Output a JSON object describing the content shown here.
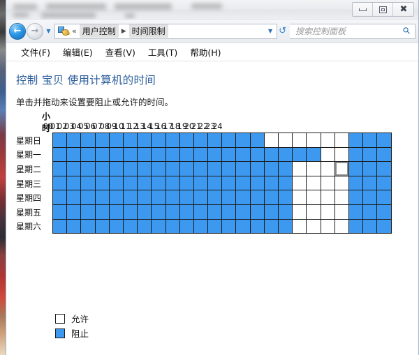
{
  "window": {
    "titlebar_redacted": true,
    "controls": [
      {
        "name": "minimize",
        "glyph": "minimize-icon"
      },
      {
        "name": "restore",
        "glyph": "restore-icon"
      },
      {
        "name": "close",
        "glyph": "close-icon"
      }
    ]
  },
  "addressbar": {
    "back_glyph": "←",
    "forward_glyph": "→",
    "recent_glyph": "▼",
    "control_panel_icon": "control-panel-icon",
    "overflow_glyph": "«",
    "crumbs": [
      "用户控制",
      "时间限制"
    ],
    "separator_glyph": "▶",
    "caret_glyph": "▼",
    "refresh_glyph": "↺",
    "search_placeholder": "搜索控制面板",
    "search_value": "",
    "search_glyph": "⚲"
  },
  "menubar": {
    "items": [
      "文件(F)",
      "编辑(E)",
      "查看(V)",
      "工具(T)",
      "帮助(H)"
    ]
  },
  "page": {
    "title": "控制 宝贝 使用计算机的时间",
    "subtitle": "单击并拖动来设置要阻止或允许的时间。"
  },
  "schedule": {
    "hours_label": "小时",
    "hour_ticks": [
      "00",
      "01",
      "02",
      "03",
      "04",
      "05",
      "06",
      "07",
      "08",
      "09",
      "10",
      "11",
      "12",
      "13",
      "14",
      "15",
      "16",
      "17",
      "18",
      "19",
      "20",
      "21",
      "22",
      "23",
      "24"
    ],
    "days": [
      "星期日",
      "星期一",
      "星期二",
      "星期三",
      "星期四",
      "星期五",
      "星期六"
    ],
    "colors": {
      "blocked": "#3d99f0",
      "allowed": "#ffffff",
      "gridline": "#1b1b1b",
      "focus_outline": "#8d8d8d"
    },
    "focused_cell": {
      "day_index": 2,
      "hour_index": 20
    },
    "rows": [
      {
        "day": "星期日",
        "cells": [
          1,
          1,
          1,
          1,
          1,
          1,
          1,
          1,
          1,
          1,
          1,
          1,
          1,
          1,
          1,
          0,
          0,
          0,
          0,
          0,
          0,
          1,
          1,
          1
        ]
      },
      {
        "day": "星期一",
        "cells": [
          1,
          1,
          1,
          1,
          1,
          1,
          1,
          1,
          1,
          1,
          1,
          1,
          1,
          1,
          1,
          1,
          1,
          1,
          1,
          0,
          0,
          1,
          1,
          1
        ]
      },
      {
        "day": "星期二",
        "cells": [
          1,
          1,
          1,
          1,
          1,
          1,
          1,
          1,
          1,
          1,
          1,
          1,
          1,
          1,
          1,
          1,
          1,
          0,
          0,
          0,
          0,
          1,
          1,
          1
        ]
      },
      {
        "day": "星期三",
        "cells": [
          1,
          1,
          1,
          1,
          1,
          1,
          1,
          1,
          1,
          1,
          1,
          1,
          1,
          1,
          1,
          1,
          1,
          0,
          0,
          0,
          0,
          1,
          1,
          1
        ]
      },
      {
        "day": "星期四",
        "cells": [
          1,
          1,
          1,
          1,
          1,
          1,
          1,
          1,
          1,
          1,
          1,
          1,
          1,
          1,
          1,
          1,
          1,
          0,
          0,
          0,
          0,
          1,
          1,
          1
        ]
      },
      {
        "day": "星期五",
        "cells": [
          1,
          1,
          1,
          1,
          1,
          1,
          1,
          1,
          1,
          1,
          1,
          1,
          1,
          1,
          1,
          1,
          1,
          0,
          0,
          0,
          0,
          1,
          1,
          1
        ]
      },
      {
        "day": "星期六",
        "cells": [
          1,
          1,
          1,
          1,
          1,
          1,
          1,
          1,
          1,
          1,
          1,
          1,
          1,
          1,
          1,
          1,
          1,
          0,
          0,
          0,
          0,
          1,
          1,
          1
        ]
      }
    ]
  },
  "legend": [
    {
      "state": "allowed",
      "label": "允许"
    },
    {
      "state": "blocked",
      "label": "阻止"
    }
  ]
}
